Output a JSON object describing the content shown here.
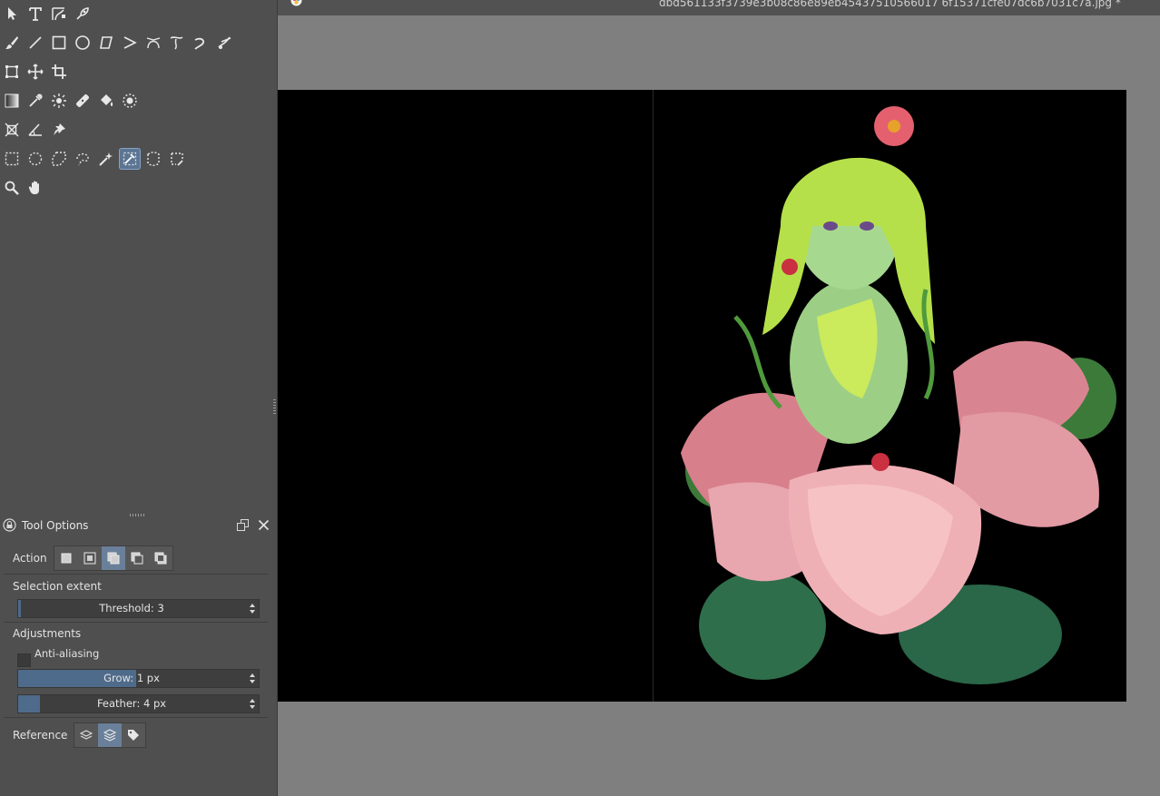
{
  "document": {
    "title": "dbd561133f3739e3b08c86e89eb45437510566017 6f15371cfe07dc6b7031c7a.jpg *"
  },
  "toolbox": {
    "rows": [
      [
        {
          "name": "select-icon"
        },
        {
          "name": "text-icon"
        },
        {
          "name": "edit-shapes-icon"
        },
        {
          "name": "calligraphy-icon"
        }
      ],
      [
        {
          "name": "brush-icon"
        },
        {
          "name": "line-icon"
        },
        {
          "name": "rectangle-icon"
        },
        {
          "name": "ellipse-icon"
        },
        {
          "name": "polygon-icon"
        },
        {
          "name": "polyline-icon"
        },
        {
          "name": "bezier-icon"
        },
        {
          "name": "freehand-path-icon"
        },
        {
          "name": "dynamic-brush-icon"
        },
        {
          "name": "multibrush-icon"
        }
      ],
      [
        {
          "name": "transform-icon"
        },
        {
          "name": "move-icon"
        },
        {
          "name": "crop-icon"
        }
      ],
      [
        {
          "name": "gradient-icon"
        },
        {
          "name": "color-picker-icon"
        },
        {
          "name": "colorize-mask-icon"
        },
        {
          "name": "smart-patch-icon"
        },
        {
          "name": "fill-icon"
        },
        {
          "name": "enclose-fill-icon"
        }
      ],
      [
        {
          "name": "assistant-icon"
        },
        {
          "name": "measure-icon"
        },
        {
          "name": "reference-pin-icon"
        }
      ],
      [
        {
          "name": "rect-select-icon"
        },
        {
          "name": "ellipse-select-icon"
        },
        {
          "name": "polygon-select-icon"
        },
        {
          "name": "freehand-select-icon"
        },
        {
          "name": "contiguous-select-icon"
        },
        {
          "name": "similar-select-icon",
          "active": true
        },
        {
          "name": "bezier-select-icon"
        },
        {
          "name": "magnetic-select-icon"
        }
      ],
      [
        {
          "name": "zoom-icon"
        },
        {
          "name": "pan-icon"
        }
      ]
    ]
  },
  "tool_options": {
    "title": "Tool Options",
    "action_label": "Action",
    "selection_extent_label": "Selection extent",
    "threshold": {
      "label": "Threshold: 3",
      "value": 3,
      "fraction": 0.01
    },
    "adjustments_label": "Adjustments",
    "anti_aliasing_label": "Anti-aliasing",
    "anti_aliasing_checked": false,
    "grow": {
      "label": "Grow:",
      "value": "1 px",
      "fraction": 0.49
    },
    "feather": {
      "label": "Feather: 4 px",
      "value": 4,
      "fraction": 0.09
    },
    "reference_label": "Reference"
  },
  "colors": {
    "accent": "#5c7593",
    "panel": "#4f4f4f",
    "canvas_bg": "#7f7f7f",
    "image_bg": "#000000"
  }
}
